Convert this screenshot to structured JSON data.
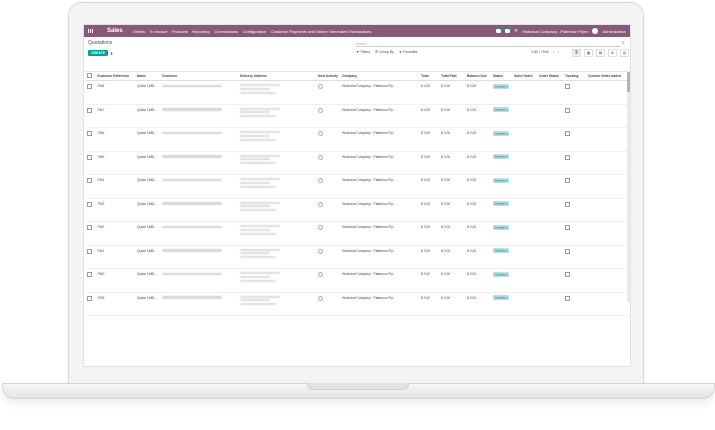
{
  "navbar": {
    "app_name": "Sales",
    "menu": [
      "Orders",
      "To Invoice",
      "Products",
      "Reporting",
      "Commissions",
      "Configuration",
      "Customer Payments and Online Generated Transactions"
    ],
    "company": "Historical Company - Patterson Flynn",
    "user": "Administrator"
  },
  "control": {
    "breadcrumb": "Quotations",
    "create_label": "CREATE",
    "search_placeholder": "Search...",
    "filters_label": "Filters",
    "groupby_label": "Group By",
    "favorites_label": "Favorites",
    "pager": "1-80 / 7949"
  },
  "table": {
    "headers": [
      "Customer Reference",
      "Name",
      "Customer",
      "Delivery Address",
      "Next Activity",
      "Company",
      "Total",
      "Total Paid",
      "Balance Due",
      "Status",
      "Sales Notes",
      "Order Status",
      "Tracking",
      "Custom Notes added"
    ],
    "rows": [
      {
        "ref": "7948",
        "name": "Quote 1682...",
        "company": "Historical Company - Patterson Fly...",
        "total": "$ 0.00",
        "paid": "$ 0.00",
        "balance": "$ 0.00",
        "status": "Quotation"
      },
      {
        "ref": "7947",
        "name": "Quote 1682...",
        "company": "Historical Company - Patterson Fly...",
        "total": "$ 0.00",
        "paid": "$ 0.00",
        "balance": "$ 0.00",
        "status": "Quotation"
      },
      {
        "ref": "7946",
        "name": "Quote 1682...",
        "company": "Historical Company - Patterson Fly...",
        "total": "$ 0.00",
        "paid": "$ 0.00",
        "balance": "$ 0.00",
        "status": "Quotation"
      },
      {
        "ref": "7945",
        "name": "Quote 1682...",
        "company": "Historical Company - Patterson Fly...",
        "total": "$ 0.00",
        "paid": "$ 0.00",
        "balance": "$ 0.00",
        "status": "Quotation"
      },
      {
        "ref": "7944",
        "name": "Quote 1682...",
        "company": "Historical Company - Patterson Fly...",
        "total": "$ 0.00",
        "paid": "$ 0.00",
        "balance": "$ 0.00",
        "status": "Quotation"
      },
      {
        "ref": "7943",
        "name": "Quote 1682...",
        "company": "Historical Company - Patterson Fly...",
        "total": "$ 0.00",
        "paid": "$ 0.00",
        "balance": "$ 0.00",
        "status": "Quotation"
      },
      {
        "ref": "7942",
        "name": "Quote 1682...",
        "company": "Historical Company - Patterson Fly...",
        "total": "$ 0.00",
        "paid": "$ 0.00",
        "balance": "$ 0.00",
        "status": "Quotation"
      },
      {
        "ref": "7941",
        "name": "Quote 1682...",
        "company": "Historical Company - Patterson Fly...",
        "total": "$ 0.00",
        "paid": "$ 0.00",
        "balance": "$ 0.00",
        "status": "Quotation"
      },
      {
        "ref": "7940",
        "name": "Quote 1682...",
        "company": "Historical Company - Patterson Fly...",
        "total": "$ 0.00",
        "paid": "$ 0.00",
        "balance": "$ 0.00",
        "status": "Quotation"
      },
      {
        "ref": "7939",
        "name": "Quote 1682...",
        "company": "Historical Company - Patterson Fly...",
        "total": "$ 0.00",
        "paid": "$ 0.00",
        "balance": "$ 0.00",
        "status": "Quotation"
      }
    ]
  },
  "colors": {
    "navbar": "#875a7b",
    "accent": "#00a09d",
    "status_badge": "#b3e2e6"
  }
}
